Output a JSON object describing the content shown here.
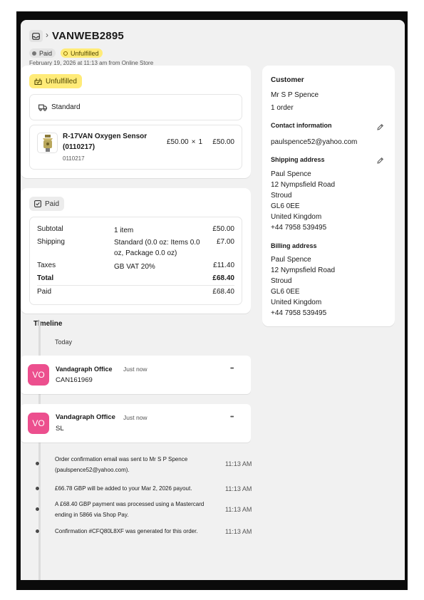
{
  "header": {
    "order_id": "VANWEB2895",
    "separator": "›",
    "paid_badge": "Paid",
    "unfulfilled_badge": "Unfulfilled",
    "subtitle": "February 19, 2026 at 11:13 am from Online Store"
  },
  "fulfillment": {
    "status": "Unfulfilled",
    "shipping_method": "Standard",
    "item": {
      "title": "R-17VAN Oxygen Sensor (0110217)",
      "sku": "0110217",
      "price": "£50.00",
      "multiply": "×",
      "quantity": "1",
      "total": "£50.00"
    }
  },
  "payment": {
    "status": "Paid",
    "rows": {
      "subtotal": {
        "label": "Subtotal",
        "detail": "1 item",
        "amount": "£50.00"
      },
      "shipping": {
        "label": "Shipping",
        "detail": "Standard (0.0 oz: Items 0.0 oz, Package 0.0 oz)",
        "amount": "£7.00"
      },
      "taxes": {
        "label": "Taxes",
        "detail": "GB VAT 20%",
        "amount": "£11.40"
      },
      "total": {
        "label": "Total",
        "amount": "£68.40"
      },
      "paid": {
        "label": "Paid",
        "amount": "£68.40"
      }
    }
  },
  "customer": {
    "heading": "Customer",
    "name": "Mr S P Spence",
    "orders": "1 order",
    "contact_heading": "Contact information",
    "email": "paulspence52@yahoo.com",
    "shipping_heading": "Shipping address",
    "shipping_address": [
      "Paul Spence",
      "12 Nympsfield Road",
      "Stroud",
      "GL6 0EE",
      "United Kingdom",
      "+44 7958 539495"
    ],
    "billing_heading": "Billing address",
    "billing_address": [
      "Paul Spence",
      "12 Nympsfield Road",
      "Stroud",
      "GL6 0EE",
      "United Kingdom",
      "+44 7958 539495"
    ]
  },
  "timeline": {
    "heading": "Timeline",
    "day": "Today",
    "comments": [
      {
        "initials": "VO",
        "author": "Vandagraph Office",
        "time": "Just now",
        "text": "CAN161969",
        "menu": "•••"
      },
      {
        "initials": "VO",
        "author": "Vandagraph Office",
        "time": "Just now",
        "text": "SL",
        "menu": "•••"
      }
    ],
    "events": [
      {
        "text": "Order confirmation email was sent to Mr S P Spence (paulspence52@yahoo.com).",
        "time": "11:13 AM"
      },
      {
        "text": "£66.78 GBP will be added to your Mar 2, 2026 payout.",
        "time": "11:13 AM"
      },
      {
        "text": "A £68.40 GBP payment was processed using a Mastercard ending in 5866 via Shop Pay.",
        "time": "11:13 AM"
      },
      {
        "text": "Confirmation #CFQ80L8XF was generated for this order.",
        "time": "11:13 AM"
      }
    ]
  },
  "colors": {
    "unfulfilled": "#ffeb78",
    "avatar": "#ec4f8e",
    "page_bg": "#f1f1f1"
  }
}
